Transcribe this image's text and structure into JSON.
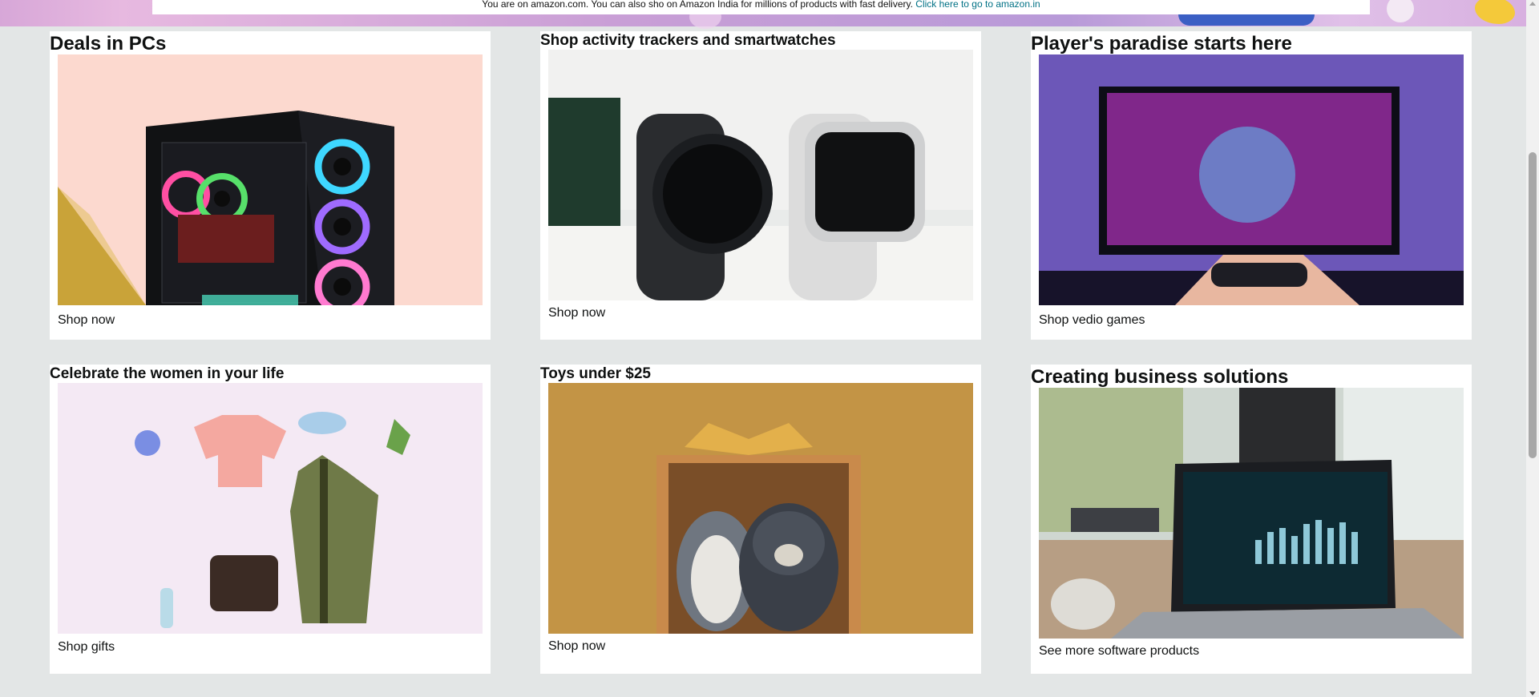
{
  "banner": {
    "notice_text": "You are on amazon.com. You can also sho on Amazon India for millions of products with fast delivery.",
    "notice_link": "Click here to go to amazon.in"
  },
  "cards": [
    {
      "title": "Deals in PCs",
      "image_alt": "Gaming PC tower with RGB fans",
      "link": "Shop now"
    },
    {
      "title": "Shop activity trackers and smartwatches",
      "image_alt": "Black and white smartwatches",
      "link": "Shop now"
    },
    {
      "title": "Player's paradise starts here",
      "image_alt": "Hands holding a game controller in front of a TV",
      "link": "Shop vedio games"
    },
    {
      "title": "Celebrate the women in your life",
      "image_alt": "Flat lay of clothing, sunglasses, shoes and a handbag",
      "link": "Shop gifts"
    },
    {
      "title": "Toys under $25",
      "image_alt": "Plush penguin and bear in a gift box",
      "link": "Shop now"
    },
    {
      "title": "Creating business solutions",
      "image_alt": "Laptop showing a dashboard on a desk",
      "link": "See more software products"
    }
  ],
  "icons": {
    "scroll_up": "scroll-up-arrow-icon",
    "scroll_down": "scroll-down-arrow-icon"
  },
  "colors": {
    "page_bg": "#e3e6e6",
    "card_bg": "#ffffff",
    "link": "#007185"
  }
}
